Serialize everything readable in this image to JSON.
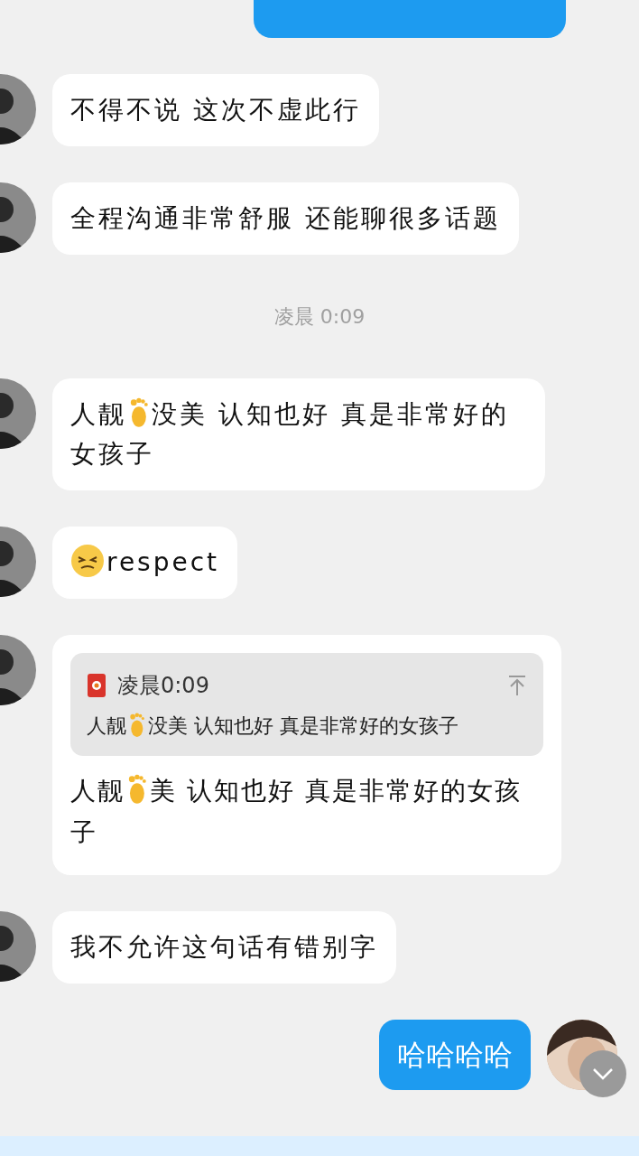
{
  "messages": [
    {
      "kind": "incoming",
      "parts": [
        "不得不说 这次不虚此行"
      ]
    },
    {
      "kind": "incoming",
      "parts": [
        "全程沟通非常舒服 还能聊很多话题"
      ]
    },
    {
      "kind": "time",
      "text": "凌晨 0:09"
    },
    {
      "kind": "incoming",
      "parts": [
        "人靓",
        "没美 认知也好 真是非常好的女孩子"
      ]
    },
    {
      "kind": "incoming",
      "leading_icon": true,
      "parts": [
        "respect"
      ]
    },
    {
      "kind": "quote",
      "quote_time": "凌晨0:09",
      "quote_parts": [
        "人靓",
        "没美 认知也好 真是非常好的女孩子"
      ],
      "parts": [
        "人靓",
        "美 认知也好 真是非常好的女孩子"
      ]
    },
    {
      "kind": "incoming",
      "parts": [
        "我不允许这句话有错别字"
      ]
    },
    {
      "kind": "outgoing",
      "parts": [
        "哈哈哈哈"
      ]
    }
  ]
}
